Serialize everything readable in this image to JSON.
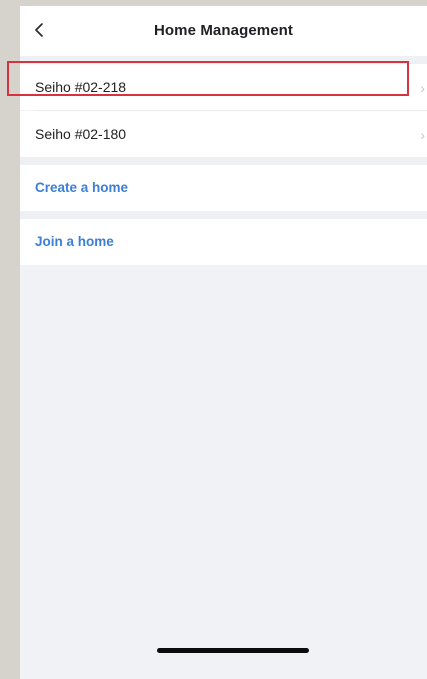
{
  "header": {
    "title": "Home Management",
    "back_icon": "chevron-left-icon"
  },
  "homes": [
    {
      "name": "Seiho #02-218",
      "selected": true
    },
    {
      "name": "Seiho #02-180",
      "selected": false
    }
  ],
  "actions": {
    "create": "Create a home",
    "join": "Join a home"
  },
  "colors": {
    "accent": "#3b7fd6",
    "highlight": "#d7323f",
    "background": "#f0f2f6"
  }
}
